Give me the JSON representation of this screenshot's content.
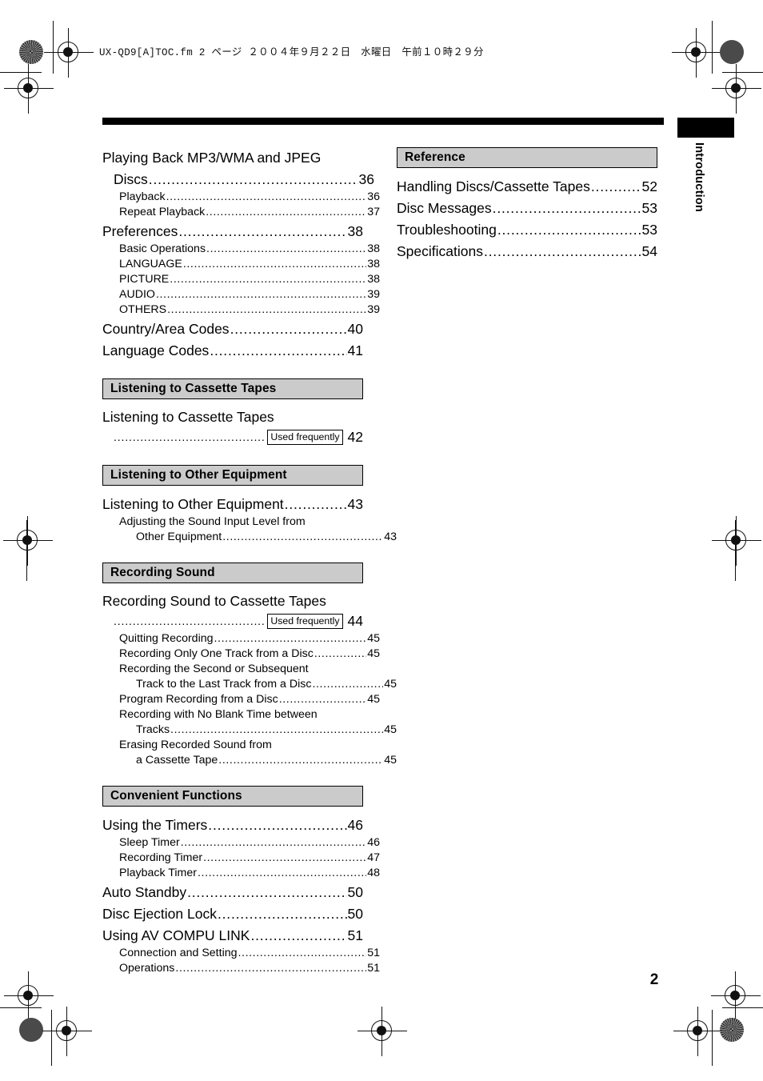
{
  "slug": "UX-QD9[A]TOC.fm  2 ページ  ２００４年９月２２日　水曜日　午前１０時２９分",
  "page": {
    "folio": "2",
    "tab_label": "Introduction",
    "badge_label": "Used frequently"
  },
  "colors": {
    "banner_fill": "#cbcbcb",
    "rule": "#000000"
  },
  "left_column": {
    "groups": [
      {
        "banner": null,
        "entries": [
          {
            "level": 1,
            "text": "Playing Back MP3/WMA and JPEG",
            "leader": false,
            "page": ""
          },
          {
            "level": 1,
            "text": "Discs",
            "leader": true,
            "page": "36",
            "cont": true
          },
          {
            "level": 2,
            "text": "Playback",
            "leader": true,
            "page": "36"
          },
          {
            "level": 2,
            "text": "Repeat Playback",
            "leader": true,
            "page": "37"
          },
          {
            "level": 1,
            "text": "Preferences",
            "leader": true,
            "page": "38"
          },
          {
            "level": 2,
            "text": "Basic Operations",
            "leader": true,
            "page": "38"
          },
          {
            "level": 2,
            "text": "LANGUAGE",
            "leader": true,
            "page": "38"
          },
          {
            "level": 2,
            "text": "PICTURE",
            "leader": true,
            "page": "38"
          },
          {
            "level": 2,
            "text": "AUDIO",
            "leader": true,
            "page": "39"
          },
          {
            "level": 2,
            "text": "OTHERS",
            "leader": true,
            "page": "39"
          },
          {
            "level": 1,
            "text": "Country/Area Codes",
            "leader": true,
            "page": "40"
          },
          {
            "level": 1,
            "text": "Language Codes",
            "leader": true,
            "page": "41"
          }
        ]
      },
      {
        "banner": "Listening to Cassette Tapes",
        "entries": [
          {
            "level": 1,
            "text": "Listening to Cassette Tapes",
            "leader": false,
            "page": ""
          },
          {
            "level": 1,
            "badge": true,
            "page": "42"
          }
        ]
      },
      {
        "banner": "Listening to Other Equipment",
        "entries": [
          {
            "level": 1,
            "text": "Listening to Other Equipment",
            "leader": true,
            "page": "43"
          },
          {
            "level": 2,
            "text": "Adjusting the Sound Input Level from",
            "leader": false,
            "page": ""
          },
          {
            "level": 2,
            "text": "Other Equipment",
            "leader": true,
            "page": "43",
            "cont": true
          }
        ]
      },
      {
        "banner": "Recording Sound",
        "entries": [
          {
            "level": 1,
            "text": "Recording Sound to Cassette Tapes",
            "leader": false,
            "page": ""
          },
          {
            "level": 1,
            "badge": true,
            "page": "44"
          },
          {
            "level": 2,
            "text": "Quitting Recording",
            "leader": true,
            "page": "45"
          },
          {
            "level": 2,
            "text": "Recording Only One Track from a Disc",
            "leader": true,
            "page": "45"
          },
          {
            "level": 2,
            "text": "Recording the Second or Subsequent",
            "leader": false,
            "page": ""
          },
          {
            "level": 2,
            "text": "Track to the Last Track from a Disc",
            "leader": true,
            "page": "45",
            "cont": true
          },
          {
            "level": 2,
            "text": "Program Recording from a Disc",
            "leader": true,
            "page": "45"
          },
          {
            "level": 2,
            "text": "Recording with No Blank Time between",
            "leader": false,
            "page": ""
          },
          {
            "level": 2,
            "text": "Tracks",
            "leader": true,
            "page": "45",
            "cont": true
          },
          {
            "level": 2,
            "text": "Erasing Recorded Sound from",
            "leader": false,
            "page": ""
          },
          {
            "level": 2,
            "text": "a Cassette Tape",
            "leader": true,
            "page": "45",
            "cont": true
          }
        ]
      },
      {
        "banner": "Convenient Functions",
        "entries": [
          {
            "level": 1,
            "text": "Using the Timers",
            "leader": true,
            "page": "46"
          },
          {
            "level": 2,
            "text": "Sleep Timer",
            "leader": true,
            "page": "46"
          },
          {
            "level": 2,
            "text": "Recording Timer",
            "leader": true,
            "page": "47"
          },
          {
            "level": 2,
            "text": "Playback Timer",
            "leader": true,
            "page": "48"
          },
          {
            "level": 1,
            "text": "Auto Standby",
            "leader": true,
            "page": "50"
          },
          {
            "level": 1,
            "text": "Disc Ejection Lock",
            "leader": true,
            "page": "50"
          },
          {
            "level": 1,
            "text": "Using AV COMPU LINK",
            "leader": true,
            "page": "51"
          },
          {
            "level": 2,
            "text": "Connection and Setting",
            "leader": true,
            "page": "51"
          },
          {
            "level": 2,
            "text": "Operations",
            "leader": true,
            "page": "51"
          }
        ]
      }
    ]
  },
  "right_column": {
    "groups": [
      {
        "banner": "Reference",
        "entries": [
          {
            "level": 1,
            "text": "Handling Discs/Cassette Tapes",
            "leader": true,
            "page": "52"
          },
          {
            "level": 1,
            "text": "Disc Messages",
            "leader": true,
            "page": "53"
          },
          {
            "level": 1,
            "text": "Troubleshooting",
            "leader": true,
            "page": "53"
          },
          {
            "level": 1,
            "text": "Specifications",
            "leader": true,
            "page": "54"
          }
        ]
      }
    ]
  }
}
